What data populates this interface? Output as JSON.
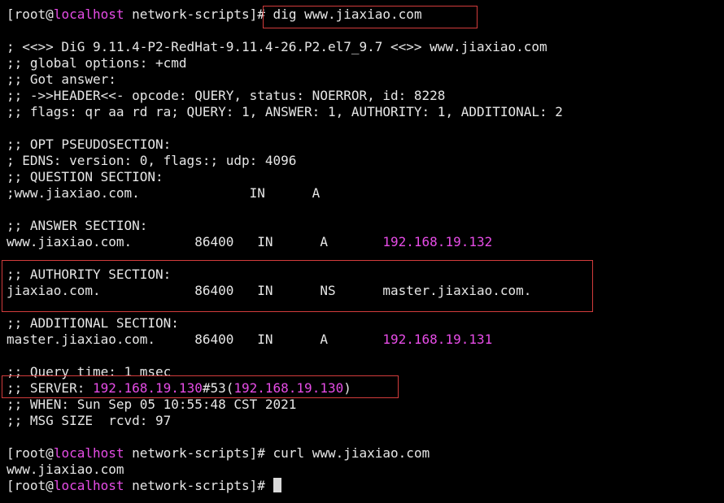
{
  "prompt": {
    "user": "root",
    "at": "@",
    "host": "localhost",
    "cwd": " network-scripts",
    "suffix": "]# "
  },
  "commands": {
    "dig": "dig www.jiaxiao.com",
    "curl": "curl www.jiaxiao.com"
  },
  "output": {
    "banner": "; <<>> DiG 9.11.4-P2-RedHat-9.11.4-26.P2.el7_9.7 <<>> www.jiaxiao.com",
    "global_options": ";; global options: +cmd",
    "got_answer": ";; Got answer:",
    "header": ";; ->>HEADER<<- opcode: QUERY, status: NOERROR, id: 8228",
    "flags": ";; flags: qr aa rd ra; QUERY: 1, ANSWER: 1, AUTHORITY: 1, ADDITIONAL: 2",
    "opt_title": ";; OPT PSEUDOSECTION:",
    "edns": "; EDNS: version: 0, flags:; udp: 4096",
    "question_title": ";; QUESTION SECTION:",
    "question_row": ";www.jiaxiao.com.              IN      A",
    "answer_title": ";; ANSWER SECTION:",
    "answer_prefix": "www.jiaxiao.com.        86400   IN      A       ",
    "answer_ip": "192.168.19.132",
    "authority_title": ";; AUTHORITY SECTION:",
    "authority_row": "jiaxiao.com.            86400   IN      NS      master.jiaxiao.com.",
    "additional_title": ";; ADDITIONAL SECTION:",
    "additional_prefix": "master.jiaxiao.com.     86400   IN      A       ",
    "additional_ip": "192.168.19.131",
    "query_time": ";; Query time: 1 msec",
    "server_prefix": ";; SERVER: ",
    "server_ip": "192.168.19.130",
    "server_port": "#53(",
    "server_ip2": "192.168.19.130",
    "server_close": ")",
    "when": ";; WHEN: Sun Sep 05 10:55:48 CST 2021",
    "msg_size": ";; MSG SIZE  rcvd: 97",
    "curl_result": "www.jiaxiao.com"
  },
  "colors": {
    "background": "#000000",
    "text": "#e6e6e6",
    "highlight": "#e64ce6",
    "annotation_box": "#d23c3c"
  }
}
